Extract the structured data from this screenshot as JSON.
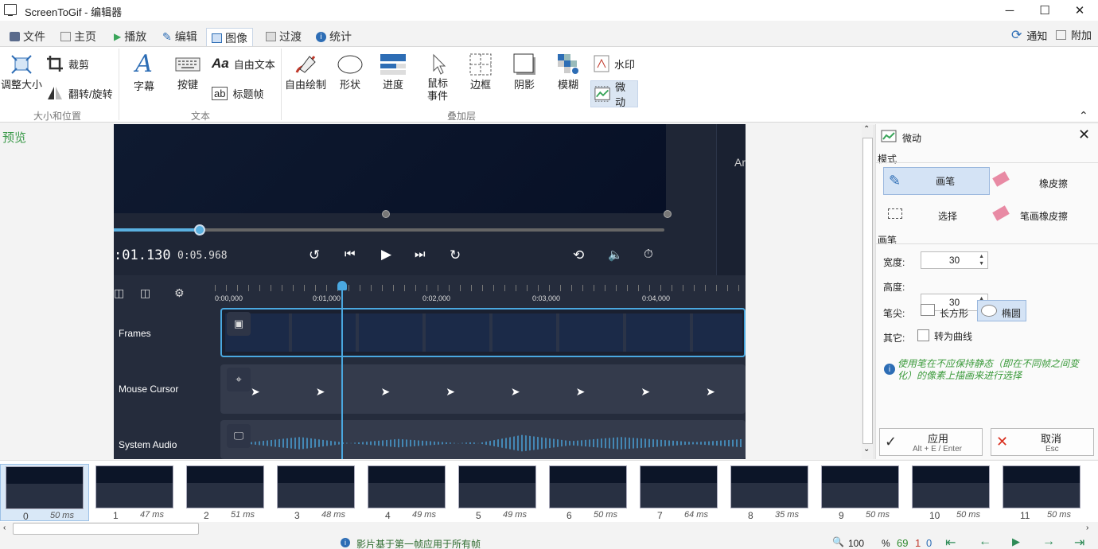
{
  "window": {
    "title": "ScreenToGif - 编辑器",
    "min": "─",
    "max": "☐",
    "close": "✕"
  },
  "tabs": [
    {
      "label": "文件",
      "color": "#5a6b8c"
    },
    {
      "label": "主页",
      "color": "#888"
    },
    {
      "label": "播放",
      "color": "#3aa55a"
    },
    {
      "label": "编辑",
      "color": "#2d6db5"
    },
    {
      "label": "图像",
      "color": "#2d6db5"
    },
    {
      "label": "过渡",
      "color": "#888"
    },
    {
      "label": "统计",
      "color": "#2d6db5"
    }
  ],
  "top_right": {
    "notify": "通知",
    "addon": "附加"
  },
  "ribbon": {
    "resize": "调整大小",
    "crop": "裁剪",
    "flip": "翻转/旋转",
    "group_size": "大小和位置",
    "caption": "字幕",
    "keys": "按键",
    "freetext": "自由文本",
    "titleframe": "标题帧",
    "group_text": "文本",
    "freedraw": "自由绘制",
    "shape": "形状",
    "progress": "进度",
    "mouse_events": "鼠标\n事件",
    "border": "边框",
    "shadow": "阴影",
    "blur": "模糊",
    "watermark": "水印",
    "cinemagraph": "微动",
    "group_overlay": "叠加层"
  },
  "preview_label": "预览",
  "player": {
    "current_time": ":01.130",
    "total_time": "0:05.968",
    "side_label": "Ar"
  },
  "timeline": {
    "ticks": [
      "0:00,000",
      "0:01,000",
      "0:02,000",
      "0:03,000",
      "0:04,000"
    ],
    "tracks": [
      "Frames",
      "Mouse Cursor",
      "System Audio"
    ]
  },
  "panel": {
    "title": "微动",
    "mode_label": "模式",
    "pen": "画笔",
    "eraser": "橡皮擦",
    "select": "选择",
    "stroke_eraser": "笔画橡皮擦",
    "pen_section": "画笔",
    "width_label": "宽度:",
    "width_value": "30",
    "height_label": "高度:",
    "height_value": "30",
    "tip_label": "笔尖:",
    "rect": "长方形",
    "ellipse": "椭圆",
    "other_label": "其它:",
    "to_curve": "转为曲线",
    "info": "使用笔在不应保持静态（即在不同帧之间变化）的像素上描画来进行选择",
    "apply": "应用",
    "apply_hint": "Alt + E / Enter",
    "cancel": "取消",
    "cancel_hint": "Esc"
  },
  "frames": [
    {
      "num": "0",
      "ms": "50 ms"
    },
    {
      "num": "1",
      "ms": "47 ms"
    },
    {
      "num": "2",
      "ms": "51 ms"
    },
    {
      "num": "3",
      "ms": "48 ms"
    },
    {
      "num": "4",
      "ms": "49 ms"
    },
    {
      "num": "5",
      "ms": "49 ms"
    },
    {
      "num": "6",
      "ms": "50 ms"
    },
    {
      "num": "7",
      "ms": "64 ms"
    },
    {
      "num": "8",
      "ms": "35 ms"
    },
    {
      "num": "9",
      "ms": "50 ms"
    },
    {
      "num": "10",
      "ms": "50 ms"
    },
    {
      "num": "11",
      "ms": "50 ms"
    }
  ],
  "status": {
    "message": "影片基于第一帧应用于所有帧",
    "zoom": "100",
    "percent": "%",
    "total": "69",
    "selected": "1",
    "current": "0"
  }
}
